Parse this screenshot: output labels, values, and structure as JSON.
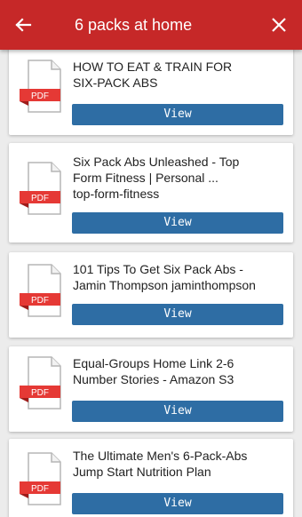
{
  "app_bar": {
    "title": "6 packs at home",
    "back_icon": "arrow-left-icon",
    "close_icon": "close-icon",
    "background": "#c62828"
  },
  "results": [
    {
      "title_line1": "HOW TO EAT & TRAIN FOR",
      "title_line2": "SIX-PACK ABS",
      "title_line3": "",
      "badge": "PDF",
      "button": "View"
    },
    {
      "title_line1": "Six Pack Abs Unleashed - Top",
      "title_line2": "Form Fitness | Personal ...",
      "title_line3": "top-form-fitness",
      "badge": "PDF",
      "button": "View"
    },
    {
      "title_line1": "101 Tips To Get Six Pack Abs -",
      "title_line2": "Jamin Thompson jaminthompson",
      "title_line3": "",
      "badge": "PDF",
      "button": "View"
    },
    {
      "title_line1": "Equal-Groups Home Link 2-6",
      "title_line2": "Number Stories - Amazon S3",
      "title_line3": "",
      "badge": "PDF",
      "button": "View"
    },
    {
      "title_line1": "The Ultimate Men's 6-Pack-Abs",
      "title_line2": "Jump Start Nutrition Plan",
      "title_line3": "",
      "badge": "PDF",
      "button": "View"
    }
  ],
  "colors": {
    "button": "#2e6da4",
    "pdf_badge": "#e53935"
  }
}
